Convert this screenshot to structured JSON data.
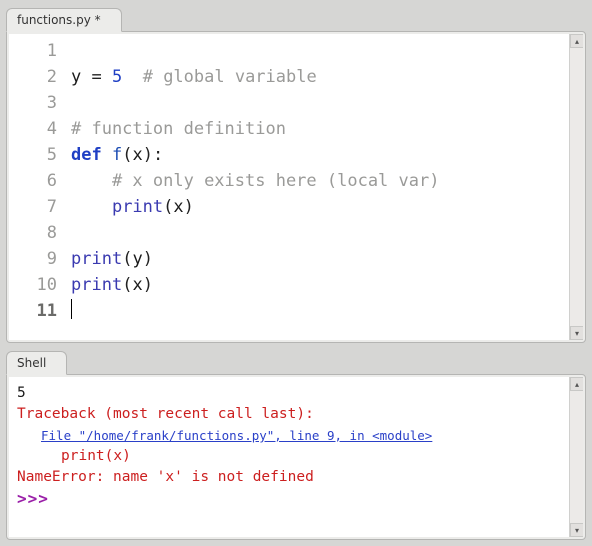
{
  "editor": {
    "tab_label": "functions.py *",
    "lines": [
      {
        "n": 1,
        "tokens": [
          {
            "t": "",
            "c": ""
          }
        ]
      },
      {
        "n": 2,
        "tokens": [
          {
            "t": "y ",
            "c": ""
          },
          {
            "t": "=",
            "c": "tk-p"
          },
          {
            "t": " ",
            "c": ""
          },
          {
            "t": "5",
            "c": "tk-num"
          },
          {
            "t": "  ",
            "c": ""
          },
          {
            "t": "# global variable",
            "c": "tk-c"
          }
        ]
      },
      {
        "n": 3,
        "tokens": []
      },
      {
        "n": 4,
        "tokens": [
          {
            "t": "# function definition",
            "c": "tk-c"
          }
        ]
      },
      {
        "n": 5,
        "tokens": [
          {
            "t": "def",
            "c": "tk-k"
          },
          {
            "t": " ",
            "c": ""
          },
          {
            "t": "f",
            "c": "tk-fn"
          },
          {
            "t": "(",
            "c": "tk-p"
          },
          {
            "t": "x",
            "c": ""
          },
          {
            "t": ")",
            "c": "tk-p"
          },
          {
            "t": ":",
            "c": "tk-p"
          }
        ]
      },
      {
        "n": 6,
        "tokens": [
          {
            "t": "    ",
            "c": ""
          },
          {
            "t": "# x only exists here (local var)",
            "c": "tk-c"
          }
        ]
      },
      {
        "n": 7,
        "tokens": [
          {
            "t": "    ",
            "c": ""
          },
          {
            "t": "print",
            "c": "tk-builtin"
          },
          {
            "t": "(",
            "c": "tk-p"
          },
          {
            "t": "x",
            "c": ""
          },
          {
            "t": ")",
            "c": "tk-p"
          }
        ]
      },
      {
        "n": 8,
        "tokens": []
      },
      {
        "n": 9,
        "tokens": [
          {
            "t": "print",
            "c": "tk-builtin"
          },
          {
            "t": "(",
            "c": "tk-p"
          },
          {
            "t": "y",
            "c": ""
          },
          {
            "t": ")",
            "c": "tk-p"
          }
        ]
      },
      {
        "n": 10,
        "tokens": [
          {
            "t": "print",
            "c": "tk-builtin"
          },
          {
            "t": "(",
            "c": "tk-p"
          },
          {
            "t": "x",
            "c": ""
          },
          {
            "t": ")",
            "c": "tk-p"
          }
        ]
      },
      {
        "n": 11,
        "tokens": [],
        "cursor": true
      }
    ]
  },
  "shell": {
    "tab_label": "Shell",
    "output": [
      {
        "cls": "sh-out",
        "text": "5"
      },
      {
        "cls": "sh-err",
        "text": "Traceback (most recent call last):"
      },
      {
        "cls": "sh-file sh-ind",
        "text": "File \"/home/frank/functions.py\", line 9, in <module>"
      },
      {
        "cls": "sh-err sh-ind2",
        "text": "print(x)"
      },
      {
        "cls": "sh-err",
        "text": "NameError: name 'x' is not defined"
      }
    ],
    "prompt": ">>>"
  }
}
